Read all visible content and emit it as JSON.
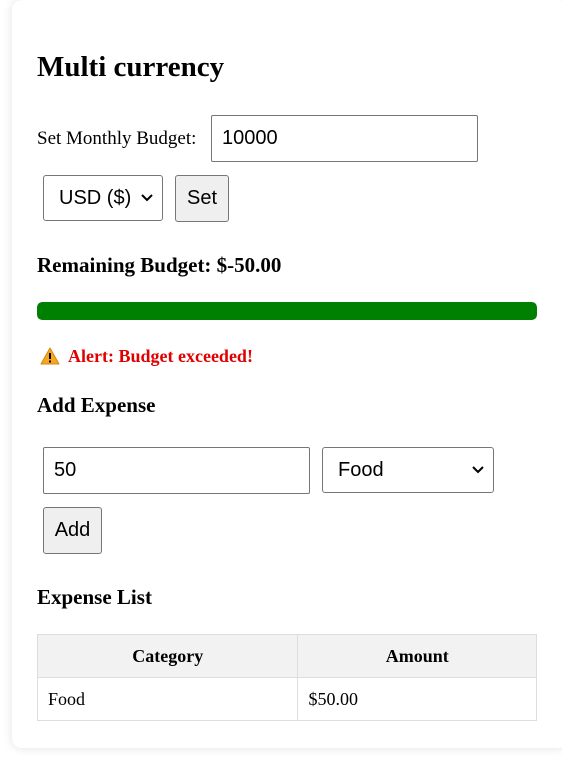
{
  "header": {
    "title": "Multi currency"
  },
  "budget": {
    "label": "Set Monthly Budget:",
    "value": "10000",
    "currency_selected": "USD ($)",
    "set_label": "Set"
  },
  "status": {
    "remaining_text": "Remaining Budget: $-50.00",
    "progress_fraction": 1.0,
    "progress_color": "#008000",
    "alert_icon": "warning-icon",
    "alert_text": "Alert: Budget exceeded!"
  },
  "add_expense": {
    "heading": "Add Expense",
    "amount_value": "50",
    "category_selected": "Food",
    "add_label": "Add"
  },
  "expense_list": {
    "heading": "Expense List",
    "columns": [
      "Category",
      "Amount"
    ],
    "rows": [
      {
        "category": "Food",
        "amount": "$50.00"
      }
    ]
  }
}
